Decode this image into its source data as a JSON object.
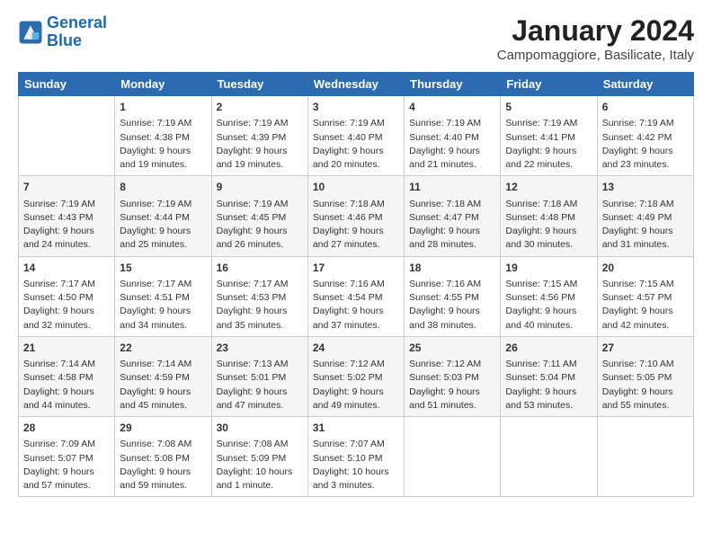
{
  "header": {
    "logo_general": "General",
    "logo_blue": "Blue",
    "title": "January 2024",
    "subtitle": "Campomaggiore, Basilicate, Italy"
  },
  "days_of_week": [
    "Sunday",
    "Monday",
    "Tuesday",
    "Wednesday",
    "Thursday",
    "Friday",
    "Saturday"
  ],
  "weeks": [
    [
      {
        "day": "",
        "info": ""
      },
      {
        "day": "1",
        "info": "Sunrise: 7:19 AM\nSunset: 4:38 PM\nDaylight: 9 hours\nand 19 minutes."
      },
      {
        "day": "2",
        "info": "Sunrise: 7:19 AM\nSunset: 4:39 PM\nDaylight: 9 hours\nand 19 minutes."
      },
      {
        "day": "3",
        "info": "Sunrise: 7:19 AM\nSunset: 4:40 PM\nDaylight: 9 hours\nand 20 minutes."
      },
      {
        "day": "4",
        "info": "Sunrise: 7:19 AM\nSunset: 4:40 PM\nDaylight: 9 hours\nand 21 minutes."
      },
      {
        "day": "5",
        "info": "Sunrise: 7:19 AM\nSunset: 4:41 PM\nDaylight: 9 hours\nand 22 minutes."
      },
      {
        "day": "6",
        "info": "Sunrise: 7:19 AM\nSunset: 4:42 PM\nDaylight: 9 hours\nand 23 minutes."
      }
    ],
    [
      {
        "day": "7",
        "info": "Sunrise: 7:19 AM\nSunset: 4:43 PM\nDaylight: 9 hours\nand 24 minutes."
      },
      {
        "day": "8",
        "info": "Sunrise: 7:19 AM\nSunset: 4:44 PM\nDaylight: 9 hours\nand 25 minutes."
      },
      {
        "day": "9",
        "info": "Sunrise: 7:19 AM\nSunset: 4:45 PM\nDaylight: 9 hours\nand 26 minutes."
      },
      {
        "day": "10",
        "info": "Sunrise: 7:18 AM\nSunset: 4:46 PM\nDaylight: 9 hours\nand 27 minutes."
      },
      {
        "day": "11",
        "info": "Sunrise: 7:18 AM\nSunset: 4:47 PM\nDaylight: 9 hours\nand 28 minutes."
      },
      {
        "day": "12",
        "info": "Sunrise: 7:18 AM\nSunset: 4:48 PM\nDaylight: 9 hours\nand 30 minutes."
      },
      {
        "day": "13",
        "info": "Sunrise: 7:18 AM\nSunset: 4:49 PM\nDaylight: 9 hours\nand 31 minutes."
      }
    ],
    [
      {
        "day": "14",
        "info": "Sunrise: 7:17 AM\nSunset: 4:50 PM\nDaylight: 9 hours\nand 32 minutes."
      },
      {
        "day": "15",
        "info": "Sunrise: 7:17 AM\nSunset: 4:51 PM\nDaylight: 9 hours\nand 34 minutes."
      },
      {
        "day": "16",
        "info": "Sunrise: 7:17 AM\nSunset: 4:53 PM\nDaylight: 9 hours\nand 35 minutes."
      },
      {
        "day": "17",
        "info": "Sunrise: 7:16 AM\nSunset: 4:54 PM\nDaylight: 9 hours\nand 37 minutes."
      },
      {
        "day": "18",
        "info": "Sunrise: 7:16 AM\nSunset: 4:55 PM\nDaylight: 9 hours\nand 38 minutes."
      },
      {
        "day": "19",
        "info": "Sunrise: 7:15 AM\nSunset: 4:56 PM\nDaylight: 9 hours\nand 40 minutes."
      },
      {
        "day": "20",
        "info": "Sunrise: 7:15 AM\nSunset: 4:57 PM\nDaylight: 9 hours\nand 42 minutes."
      }
    ],
    [
      {
        "day": "21",
        "info": "Sunrise: 7:14 AM\nSunset: 4:58 PM\nDaylight: 9 hours\nand 44 minutes."
      },
      {
        "day": "22",
        "info": "Sunrise: 7:14 AM\nSunset: 4:59 PM\nDaylight: 9 hours\nand 45 minutes."
      },
      {
        "day": "23",
        "info": "Sunrise: 7:13 AM\nSunset: 5:01 PM\nDaylight: 9 hours\nand 47 minutes."
      },
      {
        "day": "24",
        "info": "Sunrise: 7:12 AM\nSunset: 5:02 PM\nDaylight: 9 hours\nand 49 minutes."
      },
      {
        "day": "25",
        "info": "Sunrise: 7:12 AM\nSunset: 5:03 PM\nDaylight: 9 hours\nand 51 minutes."
      },
      {
        "day": "26",
        "info": "Sunrise: 7:11 AM\nSunset: 5:04 PM\nDaylight: 9 hours\nand 53 minutes."
      },
      {
        "day": "27",
        "info": "Sunrise: 7:10 AM\nSunset: 5:05 PM\nDaylight: 9 hours\nand 55 minutes."
      }
    ],
    [
      {
        "day": "28",
        "info": "Sunrise: 7:09 AM\nSunset: 5:07 PM\nDaylight: 9 hours\nand 57 minutes."
      },
      {
        "day": "29",
        "info": "Sunrise: 7:08 AM\nSunset: 5:08 PM\nDaylight: 9 hours\nand 59 minutes."
      },
      {
        "day": "30",
        "info": "Sunrise: 7:08 AM\nSunset: 5:09 PM\nDaylight: 10 hours\nand 1 minute."
      },
      {
        "day": "31",
        "info": "Sunrise: 7:07 AM\nSunset: 5:10 PM\nDaylight: 10 hours\nand 3 minutes."
      },
      {
        "day": "",
        "info": ""
      },
      {
        "day": "",
        "info": ""
      },
      {
        "day": "",
        "info": ""
      }
    ]
  ]
}
